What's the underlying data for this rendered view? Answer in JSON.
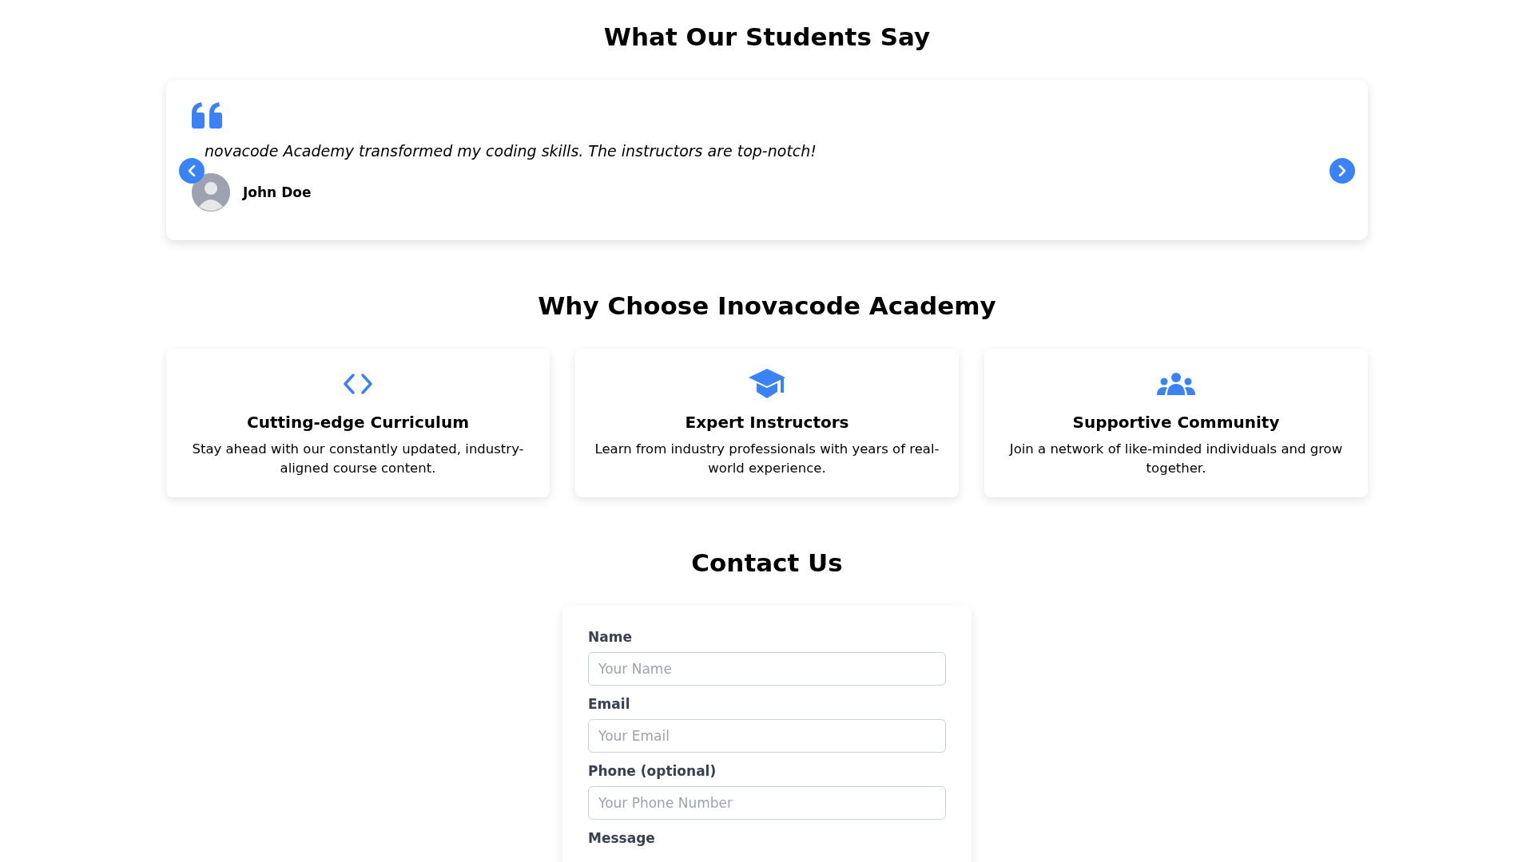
{
  "testimonials": {
    "title": "What Our Students Say",
    "quote": "novacode Academy transformed my coding skills. The instructors are top-notch!",
    "author": "John Doe"
  },
  "features": {
    "title": "Why Choose Inovacode Academy",
    "items": [
      {
        "kind": "code",
        "title": "Cutting-edge Curriculum",
        "text": "Stay ahead with our constantly updated, industry-aligned course content."
      },
      {
        "kind": "graduation",
        "title": "Expert Instructors",
        "text": "Learn from industry professionals with years of real-world experience."
      },
      {
        "kind": "people",
        "title": "Supportive Community",
        "text": "Join a network of like-minded individuals and grow together."
      }
    ]
  },
  "contact": {
    "title": "Contact Us",
    "fields": [
      {
        "label": "Name",
        "placeholder": "Your Name"
      },
      {
        "label": "Email",
        "placeholder": "Your Email"
      },
      {
        "label": "Phone (optional)",
        "placeholder": "Your Phone Number"
      },
      {
        "label": "Message"
      }
    ]
  }
}
